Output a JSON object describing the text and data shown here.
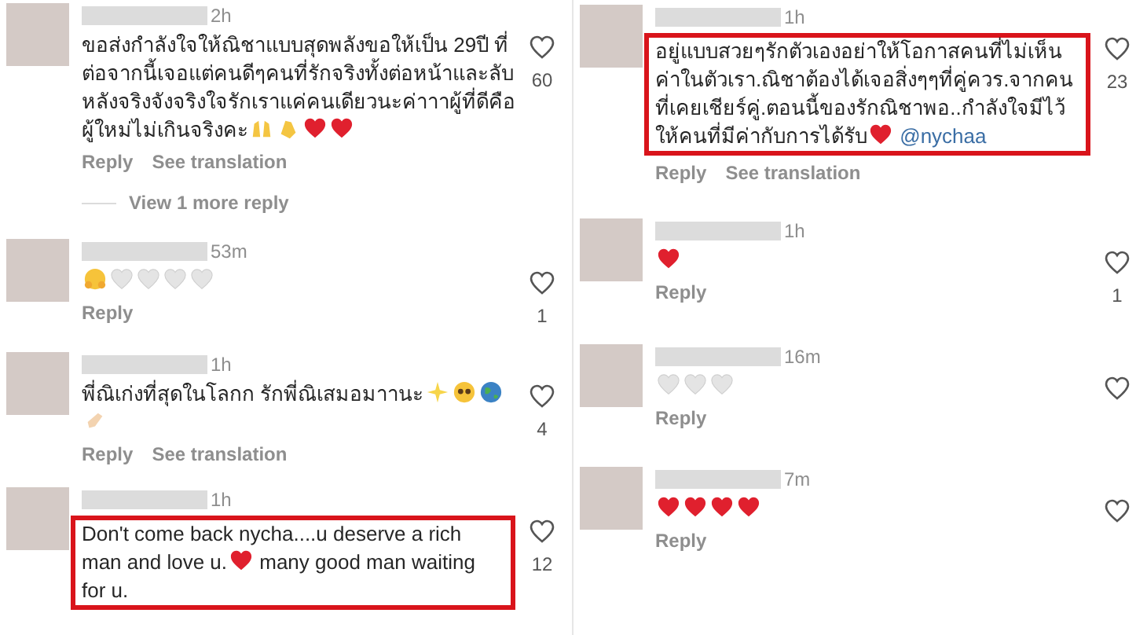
{
  "panels": [
    {
      "comments": [
        {
          "time": "2h",
          "text": "ขอส่งกำลังใจให้ณิชาแบบสุดพลังขอให้เป็น 29ปี ที่ต่อจากนี้เจอแต่คนดีๆคนที่รักจริงทั้งต่อหน้าและลับหลังจริงจังจริงใจรักเราแค่คนเดียวนะค่าาาผู้ที่ดีคือผู้ใหม่ไม่เกินจริงคะ",
          "emojis": [
            {
              "kind": "raising_hands"
            },
            {
              "kind": "clapping_hands"
            },
            {
              "kind": "red_heart"
            },
            {
              "kind": "red_heart"
            }
          ],
          "highlighted": false,
          "likes": "60",
          "actions": [
            "Reply",
            "See translation"
          ],
          "more_replies": "View 1 more reply"
        },
        {
          "time": "53m",
          "emojis": [
            {
              "kind": "hugging_face"
            },
            {
              "kind": "white_heart"
            },
            {
              "kind": "white_heart"
            },
            {
              "kind": "white_heart"
            },
            {
              "kind": "white_heart"
            }
          ],
          "highlighted": false,
          "likes": "1",
          "actions": [
            "Reply"
          ]
        },
        {
          "time": "1h",
          "text": "พี่ณิเก่งที่สุดในโลกก รักพี่ณิเสมอมาานะ",
          "emojis": [
            {
              "kind": "sparkles"
            },
            {
              "kind": "pleading_face"
            },
            {
              "kind": "globe"
            },
            {
              "kind": "hand"
            }
          ],
          "highlighted": false,
          "likes": "4",
          "actions": [
            "Reply",
            "See translation"
          ]
        },
        {
          "time": "1h",
          "text": "Don't come back nycha....u deserve a rich man and love u.",
          "emojis": [
            {
              "kind": "red_heart"
            }
          ],
          "text_after": "many good man waiting for u.",
          "highlighted": true,
          "likes": "12"
        }
      ]
    },
    {
      "comments": [
        {
          "time": "1h",
          "text": "อยู่แบบสวยๆรักตัวเองอย่าให้โอกาสคนที่ไม่เห็นค่าในตัวเรา.ณิชาต้องได้เจอสิ่งๆๆที่คู่ควร.จากคนที่เคยเชียร์คู่.ตอนนี้ของรักณิชาพอ..กำลังใจมีไว้ให้คนที่มีค่ากับการได้รับ",
          "emojis": [
            {
              "kind": "red_heart"
            }
          ],
          "mention": "@nychaa",
          "highlighted": true,
          "likes": "23",
          "actions": [
            "Reply",
            "See translation"
          ]
        },
        {
          "time": "1h",
          "emojis": [
            {
              "kind": "red_heart"
            }
          ],
          "highlighted": false,
          "likes": "1",
          "actions": [
            "Reply"
          ]
        },
        {
          "time": "16m",
          "emojis": [
            {
              "kind": "white_heart"
            },
            {
              "kind": "white_heart"
            },
            {
              "kind": "white_heart"
            }
          ],
          "highlighted": false,
          "actions": [
            "Reply"
          ]
        },
        {
          "time": "7m",
          "emojis": [
            {
              "kind": "red_heart"
            },
            {
              "kind": "red_heart"
            },
            {
              "kind": "red_heart"
            },
            {
              "kind": "red_heart"
            }
          ],
          "highlighted": false,
          "actions": [
            "Reply"
          ]
        }
      ]
    }
  ]
}
